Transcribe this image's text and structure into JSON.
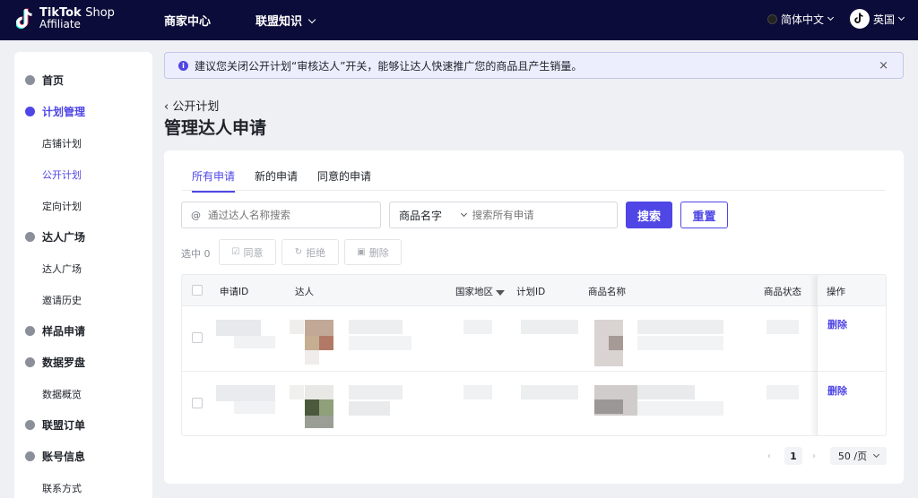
{
  "brand": {
    "line1_bold": "TikTok",
    "line1_light": "Shop",
    "line2": "Affiliate"
  },
  "topnav": {
    "items": [
      {
        "label": "商家中心"
      },
      {
        "label": "联盟知识"
      }
    ],
    "language": "简体中文",
    "region": "英国"
  },
  "sidebar": {
    "items": [
      {
        "label": "首页"
      },
      {
        "label": "计划管理"
      },
      {
        "label": "店铺计划"
      },
      {
        "label": "公开计划"
      },
      {
        "label": "定向计划"
      },
      {
        "label": "达人广场"
      },
      {
        "label": "达人广场"
      },
      {
        "label": "邀请历史"
      },
      {
        "label": "样品申请"
      },
      {
        "label": "数据罗盘"
      },
      {
        "label": "数据概览"
      },
      {
        "label": "联盟订单"
      },
      {
        "label": "账号信息"
      },
      {
        "label": "联系方式"
      }
    ]
  },
  "notice": {
    "text": "建议您关闭公开计划“审核达人”开关，能够让达人快速推广您的商品且产生销量。",
    "close": "×"
  },
  "page": {
    "back_label": "公开计划",
    "title": "管理达人申请"
  },
  "tabs": [
    {
      "label": "所有申请"
    },
    {
      "label": "新的申请"
    },
    {
      "label": "同意的申请"
    }
  ],
  "filters": {
    "creator_placeholder": "通过达人名称搜索",
    "product_select": "商品名字",
    "product_placeholder": "搜索所有申请",
    "search_button": "搜索",
    "reset_button": "重置"
  },
  "bulk": {
    "selected_label": "选中 0",
    "approve": "同意",
    "reject": "拒绝",
    "delete": "删除"
  },
  "table": {
    "columns": [
      "申请ID",
      "达人",
      "国家地区",
      "计划ID",
      "商品名称",
      "商品状态",
      "操作"
    ],
    "rows": [
      {
        "action": "删除"
      },
      {
        "action": "删除"
      }
    ]
  },
  "pagination": {
    "current_page": "1",
    "page_size": "50 /页"
  }
}
